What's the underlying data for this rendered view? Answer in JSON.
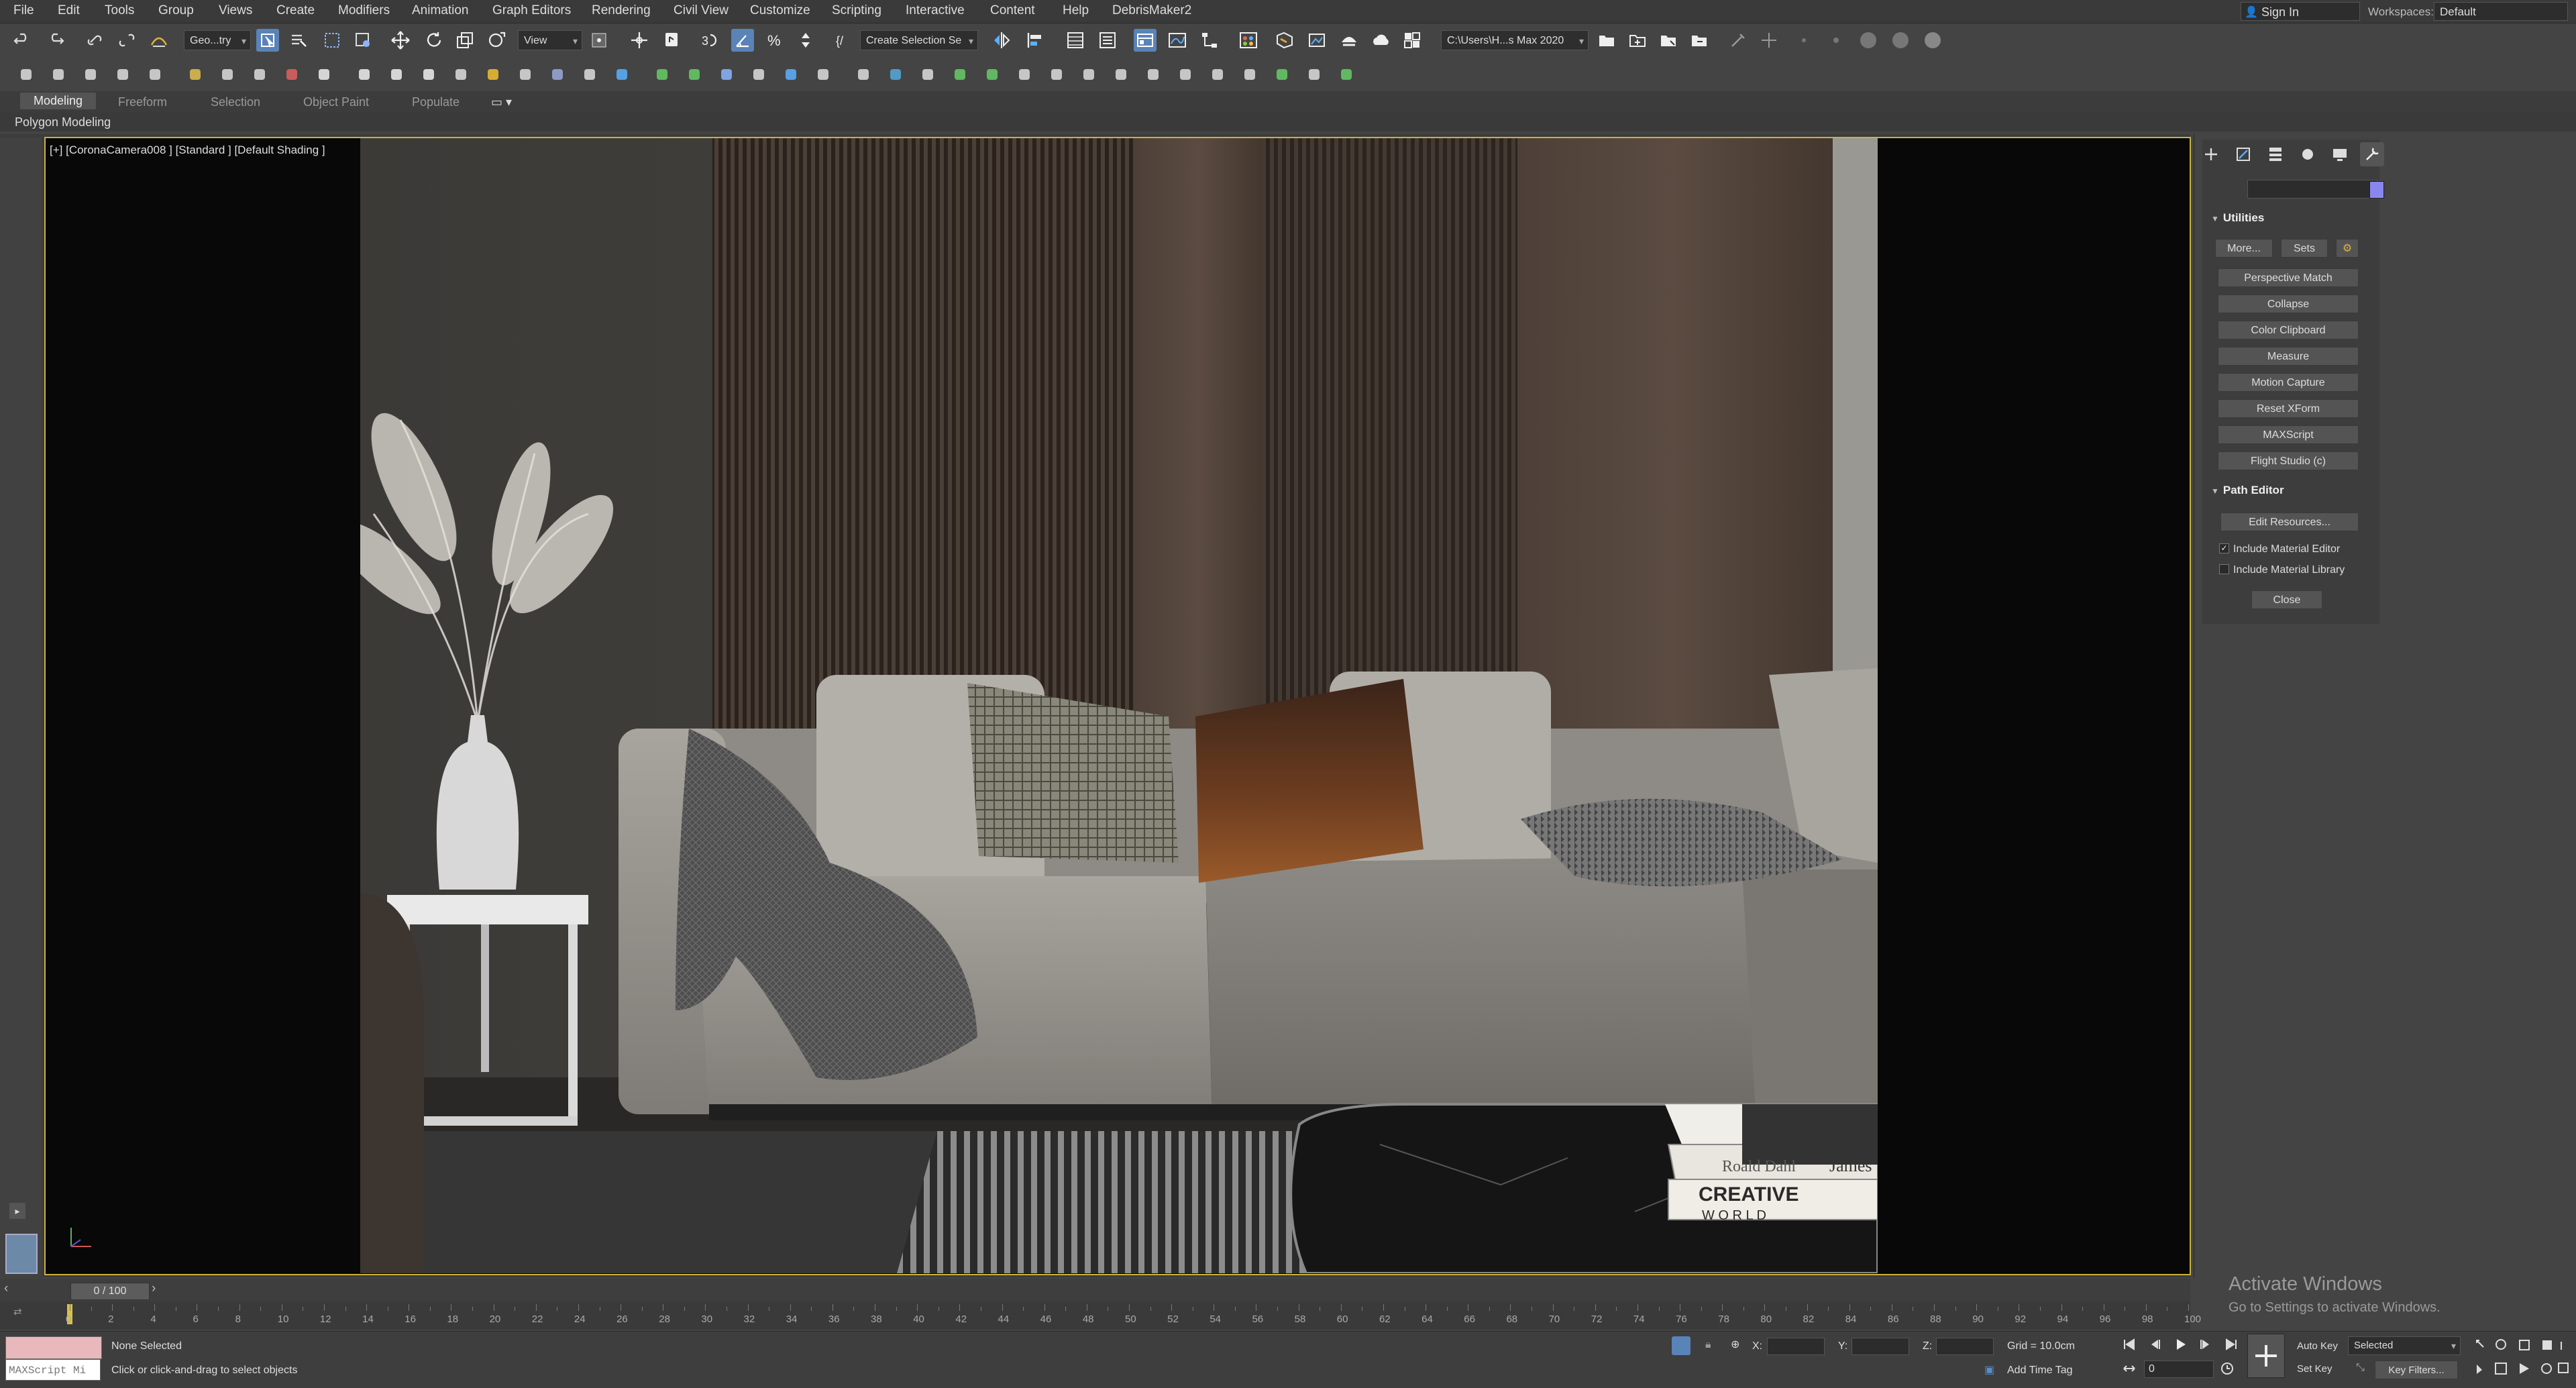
{
  "menu": {
    "items": [
      "File",
      "Edit",
      "Tools",
      "Group",
      "Views",
      "Create",
      "Modifiers",
      "Animation",
      "Graph Editors",
      "Rendering",
      "Civil View",
      "Customize",
      "Scripting",
      "Interactive",
      "Content",
      "Help",
      "DebrisMaker2"
    ],
    "sign_in": "Sign In",
    "workspaces_label": "Workspaces:",
    "workspace_value": "Default"
  },
  "toolbar": {
    "selection_filter": "Geo...try",
    "ref_coord": "View",
    "named_selection": "Create Selection Se",
    "project_path": "C:\\Users\\H...s Max 2020"
  },
  "ribbon": {
    "tabs": [
      "Modeling",
      "Freeform",
      "Selection",
      "Object Paint",
      "Populate"
    ],
    "sub_label": "Polygon Modeling"
  },
  "viewport": {
    "label": "[+] [CoronaCamera008 ] [Standard ] [Default Shading ]",
    "book_title_1": "Roald Dahl",
    "book_title_2": "James",
    "book_title_3": "CREATIVE",
    "book_title_4": "W O R L D"
  },
  "command_panel": {
    "utilities_title": "Utilities",
    "more_button": "More...",
    "sets_button": "Sets",
    "utility_buttons": [
      "Perspective Match",
      "Collapse",
      "Color Clipboard",
      "Measure",
      "Motion Capture",
      "Reset XForm",
      "MAXScript",
      "Flight Studio (c)"
    ],
    "path_editor_title": "Path Editor",
    "edit_resources_button": "Edit Resources...",
    "include_material_editor": "Include Material Editor",
    "include_material_library": "Include Material Library",
    "close_button": "Close",
    "color_swatch": "#8a86f0"
  },
  "timeline": {
    "slider_label": "0 / 100",
    "ticks": [
      "0",
      "2",
      "4",
      "6",
      "8",
      "10",
      "12",
      "14",
      "16",
      "18",
      "20",
      "22",
      "24",
      "26",
      "28",
      "30",
      "32",
      "34",
      "36",
      "38",
      "40",
      "42",
      "44",
      "46",
      "48",
      "50",
      "52",
      "54",
      "56",
      "58",
      "60",
      "62",
      "64",
      "66",
      "68",
      "70",
      "72",
      "74",
      "76",
      "78",
      "80",
      "82",
      "84",
      "86",
      "88",
      "90",
      "92",
      "94",
      "96",
      "98",
      "100"
    ]
  },
  "status": {
    "maxscript_label": "MAXScript Mi",
    "selection_status": "None Selected",
    "prompt": "Click or click-and-drag to select objects",
    "x_label": "X:",
    "y_label": "Y:",
    "z_label": "Z:",
    "grid": "Grid = 10.0cm",
    "add_time_tag": "Add Time Tag",
    "auto_key": "Auto Key",
    "set_key": "Set Key",
    "key_mode": "Selected",
    "key_filters": "Key Filters...",
    "frame": "0"
  },
  "watermark": {
    "line1": "Activate Windows",
    "line2": "Go to Settings to activate Windows."
  }
}
